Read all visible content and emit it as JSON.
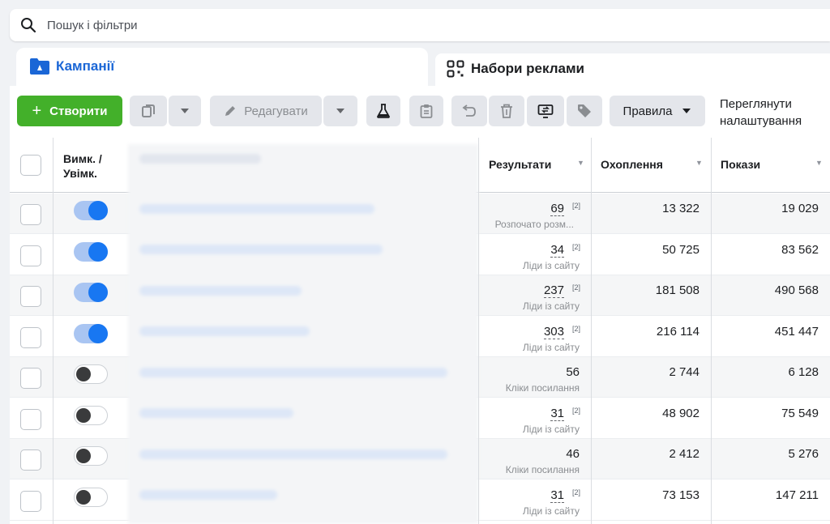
{
  "search": {
    "placeholder": "Пошук і фільтри"
  },
  "tabs": {
    "campaigns": "Кампанії",
    "ad_sets": "Набори реклами"
  },
  "toolbar": {
    "create_label": "Створити",
    "edit_label": "Редагувати",
    "rules_label": "Правила",
    "view_settings_line1": "Переглянути",
    "view_settings_line2": "налаштування"
  },
  "table": {
    "headers": {
      "on_off_line1": "Вимк. /",
      "on_off_line2": "Увімк.",
      "results": "Результати",
      "reach": "Охоплення",
      "impressions": "Покази"
    },
    "rows": [
      {
        "on": true,
        "result": "69",
        "sup": "[2]",
        "result_type": "Розпочато розм...",
        "reach": "13 322",
        "impressions": "19 029"
      },
      {
        "on": true,
        "result": "34",
        "sup": "[2]",
        "result_type": "Ліди із сайту",
        "reach": "50 725",
        "impressions": "83 562"
      },
      {
        "on": true,
        "result": "237",
        "sup": "[2]",
        "result_type": "Ліди із сайту",
        "reach": "181 508",
        "impressions": "490 568"
      },
      {
        "on": true,
        "result": "303",
        "sup": "[2]",
        "result_type": "Ліди із сайту",
        "reach": "216 114",
        "impressions": "451 447"
      },
      {
        "on": false,
        "result": "56",
        "sup": "",
        "result_type": "Кліки посилання",
        "reach": "2 744",
        "impressions": "6 128"
      },
      {
        "on": false,
        "result": "31",
        "sup": "[2]",
        "result_type": "Ліди із сайту",
        "reach": "48 902",
        "impressions": "75 549"
      },
      {
        "on": false,
        "result": "46",
        "sup": "",
        "result_type": "Кліки посилання",
        "reach": "2 412",
        "impressions": "5 276"
      },
      {
        "on": false,
        "result": "31",
        "sup": "[2]",
        "result_type": "Ліди із сайту",
        "reach": "73 153",
        "impressions": "147 211"
      }
    ]
  },
  "colors": {
    "brand_blue": "#1877f2",
    "create_green": "#43b02a",
    "tab_active_text": "#1a66d6"
  }
}
